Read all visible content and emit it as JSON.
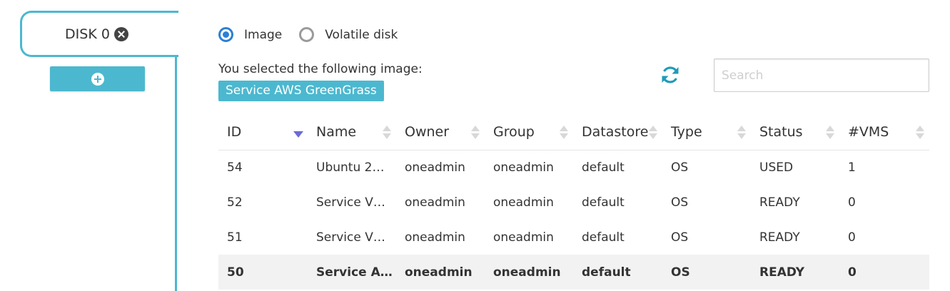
{
  "disk_tab": {
    "label": "DISK 0"
  },
  "image_source": {
    "options": [
      {
        "label": "Image",
        "checked": true
      },
      {
        "label": "Volatile disk",
        "checked": false
      }
    ]
  },
  "selection": {
    "label": "You selected the following image:",
    "selected_image": "Service AWS GreenGrass"
  },
  "search": {
    "placeholder": "Search",
    "value": ""
  },
  "table": {
    "columns": [
      "ID",
      "Name",
      "Owner",
      "Group",
      "Datastore",
      "Type",
      "Status",
      "#VMS"
    ],
    "sorted_column": "ID",
    "sort_direction": "descending",
    "rows": [
      {
        "id": "54",
        "name": "Ubuntu 2…",
        "owner": "oneadmin",
        "group": "oneadmin",
        "datastore": "default",
        "type": "OS",
        "status": "USED",
        "vms": "1",
        "selected": false
      },
      {
        "id": "52",
        "name": "Service V…",
        "owner": "oneadmin",
        "group": "oneadmin",
        "datastore": "default",
        "type": "OS",
        "status": "READY",
        "vms": "0",
        "selected": false
      },
      {
        "id": "51",
        "name": "Service V…",
        "owner": "oneadmin",
        "group": "oneadmin",
        "datastore": "default",
        "type": "OS",
        "status": "READY",
        "vms": "0",
        "selected": false
      },
      {
        "id": "50",
        "name": "Service A…",
        "owner": "oneadmin",
        "group": "oneadmin",
        "datastore": "default",
        "type": "OS",
        "status": "READY",
        "vms": "0",
        "selected": true
      }
    ]
  },
  "icons": {
    "close": "close-icon",
    "add": "plus-icon",
    "refresh": "refresh-icon",
    "sort": "sort-icon"
  },
  "colors": {
    "accent": "#4cb8cf",
    "radio_checked": "#2c7fd4",
    "sort_active": "#6b6bd6",
    "selected_row_bg": "#f2f2f2"
  }
}
